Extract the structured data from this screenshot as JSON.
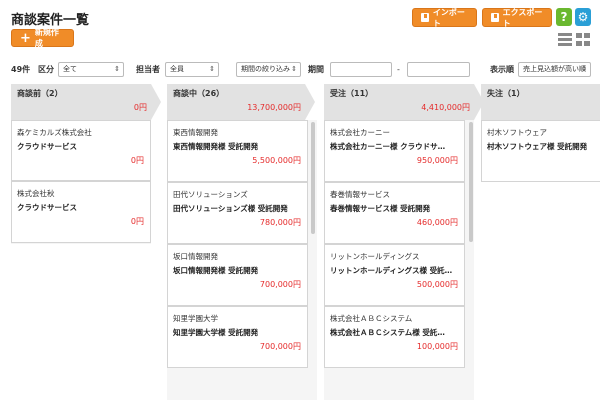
{
  "page": {
    "title": "商談案件一覧",
    "import_label": "インポート",
    "export_label": "エクスポート",
    "help_label": "?",
    "new_label": "新規作成"
  },
  "filters": {
    "count": "49件",
    "category_label": "区分",
    "category_value": "全て",
    "owner_label": "担当者",
    "owner_value": "全員",
    "period_select_value": "期間の絞り込み",
    "period_label": "期間",
    "period_from": "",
    "period_to": "",
    "range_separator": "-",
    "sort_label": "表示順",
    "sort_value": "売上見込額が高い順"
  },
  "columns": [
    {
      "name": "商談前（2）",
      "total": "0円",
      "cards": [
        {
          "client": "森ケミカルズ株式会社",
          "deal": "クラウドサービス",
          "amount": "0円"
        },
        {
          "client": "株式会社秋",
          "deal": "クラウドサービス",
          "amount": "0円"
        }
      ]
    },
    {
      "name": "商談中（26）",
      "total": "13,700,000円",
      "cards": [
        {
          "client": "東西情報開発",
          "deal": "東西情報開発様 受託開発",
          "amount": "5,500,000円"
        },
        {
          "client": "田代ソリューションズ",
          "deal": "田代ソリューションズ様 受託開発",
          "amount": "780,000円"
        },
        {
          "client": "坂口情報開発",
          "deal": "坂口情報開発様 受託開発",
          "amount": "700,000円"
        },
        {
          "client": "知里学園大学",
          "deal": "知里学園大学様 受託開発",
          "amount": "700,000円"
        }
      ]
    },
    {
      "name": "受注（11）",
      "total": "4,410,000円",
      "cards": [
        {
          "client": "株式会社カーニー",
          "deal": "株式会社カーニー様 クラウドサ…",
          "amount": "950,000円"
        },
        {
          "client": "春巻情報サービス",
          "deal": "春巻情報サービス様 受託開発",
          "amount": "460,000円"
        },
        {
          "client": "リットンホールディングス",
          "deal": "リットンホールディングス様 受託…",
          "amount": "500,000円"
        },
        {
          "client": "株式会社ＡＢＣシステム",
          "deal": "株式会社ＡＢＣシステム様 受託…",
          "amount": "100,000円"
        }
      ]
    },
    {
      "name": "失注（1）",
      "total": "",
      "cards": [
        {
          "client": "村木ソフトウェア",
          "deal": "村木ソフトウェア様 受託開発",
          "amount": ""
        }
      ]
    }
  ]
}
